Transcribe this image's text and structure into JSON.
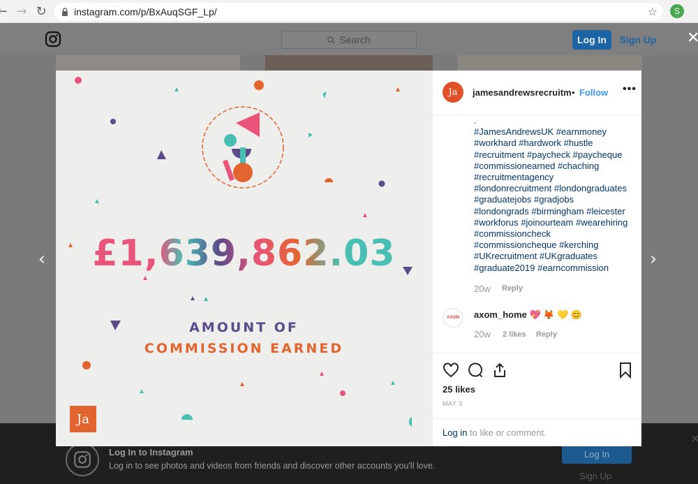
{
  "browser": {
    "url": "instagram.com/p/BxAuqSGF_Lp/",
    "profile_initial": "S"
  },
  "header": {
    "search_placeholder": "Search",
    "login_label": "Log In",
    "signup_label": "Sign Up"
  },
  "post": {
    "amount": "£1,639,862.03",
    "caption_line1": "AMOUNT OF",
    "caption_line2": "COMMISSION EARNED",
    "logo_text": "Ja",
    "colors": {
      "orange": "#e2642e",
      "pink": "#e8547a",
      "purple": "#5b4b8a",
      "teal": "#49bfb4"
    }
  },
  "side": {
    "avatar_text": "Ja",
    "username": "jamesandrewsrecruitment",
    "separator": "•",
    "follow_label": "Follow",
    "more_label": "•••",
    "hashtag_lines": [
      ".",
      "#JamesAndrewsUK #earnmoney",
      "#workhard #hardwork #hustle",
      "#recruitment #paycheck #paycheque",
      "#commissionearned #chaching",
      "#recruitmentagency",
      "#londonrecruitment #londongraduates",
      "#graduatejobs #gradjobs",
      "#londongrads #birmingham #leicester",
      "#workforus #joinourteam #wearehiring",
      "#commissioncheck",
      "#commissioncheque #kerching",
      "#UKrecruitment #UKgraduates",
      "#graduate2019 #earncommission"
    ],
    "caption_age": "20w",
    "caption_reply": "Reply",
    "comment": {
      "avatar_text": "AXOM",
      "username": "axom_home",
      "text": "💖 🦊 💛 😊",
      "age": "20w",
      "likes": "2 likes",
      "reply": "Reply"
    },
    "likes": "25 likes",
    "date": "MAY 3",
    "login_link": "Log in",
    "login_rest": " to like or comment."
  },
  "banner": {
    "title": "Log In to Instagram",
    "subtitle": "Log in to see photos and videos from friends and discover other accounts you'll love.",
    "login_label": "Log In",
    "signup_label": "Sign Up"
  }
}
